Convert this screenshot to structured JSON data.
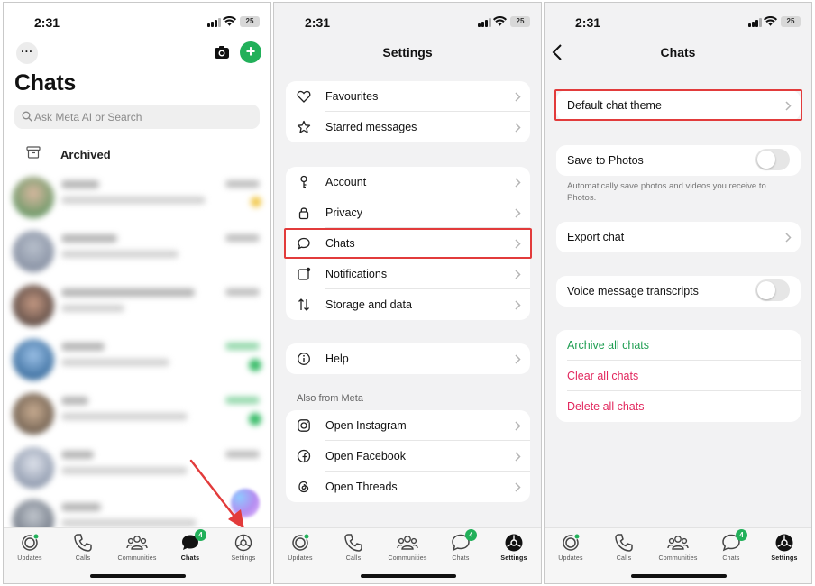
{
  "colors": {
    "accent_green": "#22b05a",
    "highlight_red": "#e23b3b",
    "danger_pink": "#e2285e",
    "archive_green": "#1f9e52"
  },
  "status_bar": {
    "time": "2:31",
    "battery": "25"
  },
  "chats_screen": {
    "title": "Chats",
    "search_placeholder": "Ask Meta AI or Search",
    "archived_label": "Archived",
    "blurred_chats": 7
  },
  "settings_screen": {
    "title": "Settings",
    "group1": [
      {
        "label": "Favourites",
        "icon": "heart-icon"
      },
      {
        "label": "Starred messages",
        "icon": "star-icon"
      }
    ],
    "group2": [
      {
        "label": "Account",
        "icon": "key-icon"
      },
      {
        "label": "Privacy",
        "icon": "lock-icon"
      },
      {
        "label": "Chats",
        "icon": "chat-bubble-icon"
      },
      {
        "label": "Notifications",
        "icon": "notification-icon"
      },
      {
        "label": "Storage and data",
        "icon": "arrows-updown-icon"
      }
    ],
    "group3": [
      {
        "label": "Help",
        "icon": "info-icon"
      }
    ],
    "also_from_meta_header": "Also from Meta",
    "group4": [
      {
        "label": "Open Instagram",
        "icon": "instagram-icon"
      },
      {
        "label": "Open Facebook",
        "icon": "facebook-icon"
      },
      {
        "label": "Open Threads",
        "icon": "threads-icon"
      }
    ]
  },
  "chats_settings_screen": {
    "title": "Chats",
    "default_theme": "Default chat theme",
    "save_to_photos": "Save to Photos",
    "save_to_photos_note": "Automatically save photos and videos you receive to Photos.",
    "save_to_photos_on": false,
    "export_chat": "Export chat",
    "voice_transcripts": "Voice message transcripts",
    "voice_transcripts_on": false,
    "archive_all": "Archive all chats",
    "clear_all": "Clear all chats",
    "delete_all": "Delete all chats"
  },
  "tabbar": {
    "items": [
      {
        "label": "Updates",
        "icon": "updates-icon"
      },
      {
        "label": "Calls",
        "icon": "phone-icon"
      },
      {
        "label": "Communities",
        "icon": "communities-icon"
      },
      {
        "label": "Chats",
        "icon": "chats-icon",
        "badge": "4"
      },
      {
        "label": "Settings",
        "icon": "settings-gear-icon"
      }
    ]
  }
}
